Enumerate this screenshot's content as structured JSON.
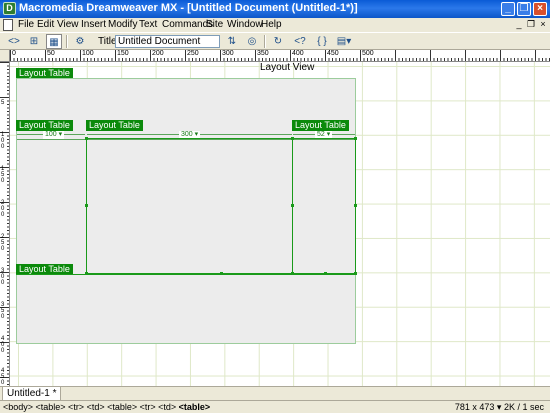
{
  "window": {
    "title": "Macromedia Dreamweaver MX - [Untitled Document (Untitled-1*)]"
  },
  "menubar": {
    "items": [
      "File",
      "Edit",
      "View",
      "Insert",
      "Modify",
      "Text",
      "Commands",
      "Site",
      "Window",
      "Help"
    ]
  },
  "toolbar": {
    "title_label": "Title:",
    "title_value": "Untitled Document",
    "buttons": [
      "code-view-icon",
      "split-view-icon",
      "design-view-icon",
      "live-data-icon",
      "file-management-icon",
      "preview-icon",
      "refresh-icon",
      "reference-icon",
      "code-nav-icon",
      "view-options-icon"
    ]
  },
  "ruler": {
    "h_labels": [
      "0",
      "50",
      "100",
      "150",
      "200",
      "250",
      "300",
      "350",
      "400",
      "450",
      "500"
    ],
    "v_labels": [
      "5",
      "1 0 0",
      "1 5 0",
      "2 0 0",
      "2 5 0",
      "3 0 0",
      "3 5 0",
      "4 0 0",
      "4 5 0"
    ]
  },
  "document": {
    "layout_view_label": "Layout View",
    "outer_table_label": "Layout Table",
    "nested_table_labels": [
      "Layout Table",
      "Layout Table",
      "Layout Table",
      "Layout Table"
    ],
    "column_widths": [
      "100 ▾",
      "300 ▾",
      "52 ▾"
    ]
  },
  "doc_tabs": [
    "Untitled-1 *"
  ],
  "status": {
    "tag_selector": "<body> <table> <tr> <td> <table> <tr> <td>",
    "tag_selected": "<table>",
    "window_size": "781 x 473 ▾",
    "download": "2K / 1 sec"
  }
}
